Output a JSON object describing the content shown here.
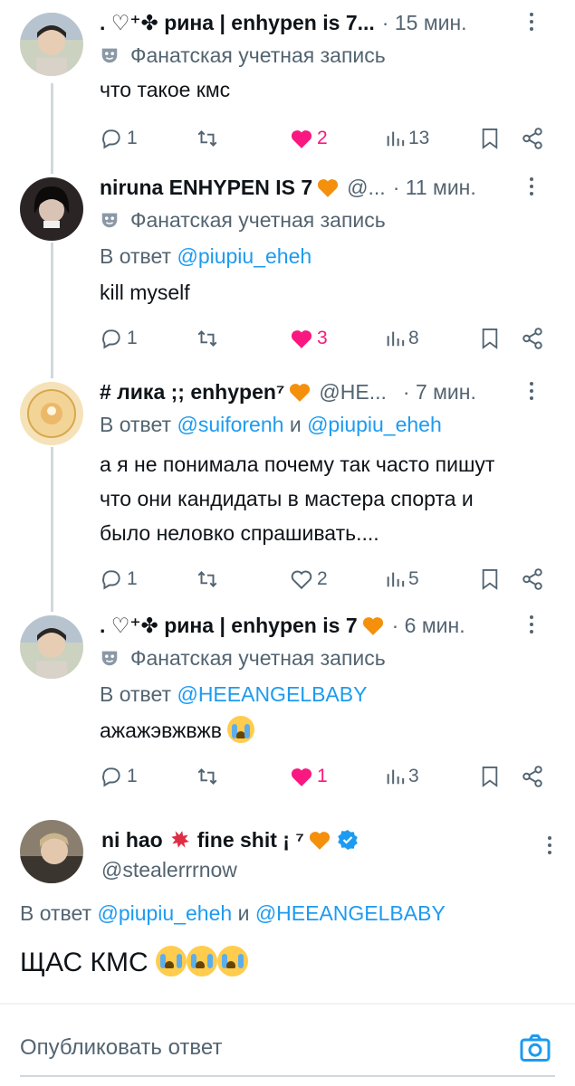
{
  "tweets": [
    {
      "name": ". ♡⁺✤ рина | enhypen is 7...",
      "handle": "",
      "time": "· 15 мин.",
      "label": "Фанатская учетная запись",
      "text": "что такое кмс",
      "stats": {
        "replies": "1",
        "retweets": "",
        "likes": "2",
        "views": "13"
      },
      "liked": true
    },
    {
      "name": "niruna ENHYPEN IS 7",
      "handle": "@...",
      "time": "· 11 мин.",
      "label": "Фанатская учетная запись",
      "reply_prefix": "В ответ",
      "reply_to": "@piupiu_eheh",
      "text": "kill myself",
      "stats": {
        "replies": "1",
        "retweets": "",
        "likes": "3",
        "views": "8"
      },
      "liked": true
    },
    {
      "name": "# лика ;; enhypen⁷",
      "handle": "@HE...",
      "time": "· 7 мин.",
      "reply_prefix": "В ответ",
      "reply_to": "@suiforenh",
      "reply_and": "и",
      "reply_to2": "@piupiu_eheh",
      "text_lines": [
        "а я не понимала почему так часто пишут",
        "что они кандидаты в мастера спорта и",
        "было неловко спрашивать...."
      ],
      "stats": {
        "replies": "1",
        "retweets": "",
        "likes": "2",
        "views": "5"
      },
      "liked": false
    },
    {
      "name": ". ♡⁺✤ рина | enhypen is 7",
      "handle": "",
      "time": "· 6 мин.",
      "label": "Фанатская учетная запись",
      "reply_prefix": "В ответ",
      "reply_to": "@HEEANGELBABY",
      "text": "ажажэвжвжв",
      "stats": {
        "replies": "1",
        "retweets": "",
        "likes": "1",
        "views": "3"
      },
      "liked": true
    }
  ],
  "main_tweet": {
    "name": "ni hao",
    "name_suffix": "fine shit ¡ ⁷",
    "handle": "@stealerrrnow",
    "reply_prefix": "В ответ",
    "reply_to": "@piupiu_eheh",
    "reply_and": "и",
    "reply_to2": "@HEEANGELBABY",
    "text": "ЩАС КМС"
  },
  "compose": {
    "placeholder": "Опубликовать ответ"
  },
  "colors": {
    "accent": "#1d9bf0",
    "like": "#f91880",
    "secondary": "#536471",
    "heart_emoji": "#f4900c"
  }
}
